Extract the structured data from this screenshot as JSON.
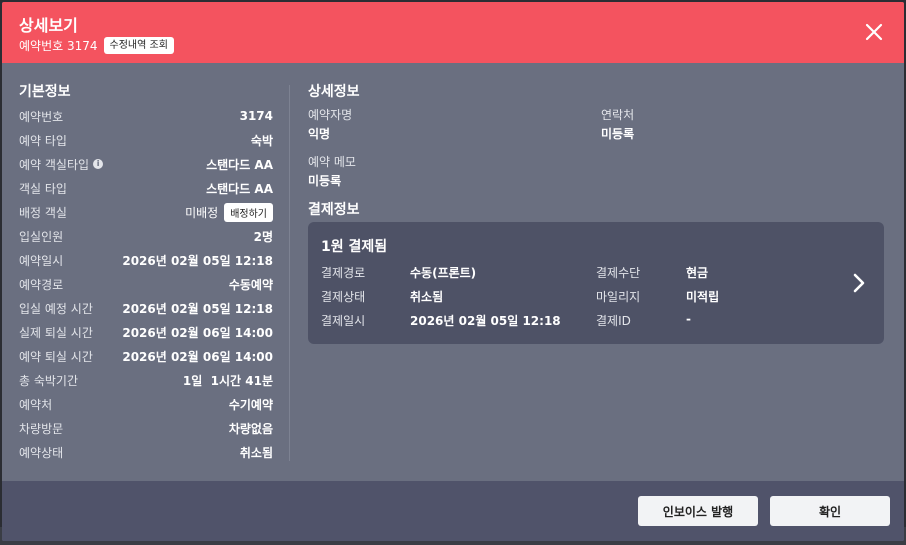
{
  "modal": {
    "title": "상세보기",
    "reservation_number_label": "예약번호 3174",
    "history_button": "수정내역 조회"
  },
  "basic_info": {
    "title": "기본정보",
    "rows": [
      {
        "label": "예약번호",
        "value": "3174"
      },
      {
        "label": "예약 타입",
        "value": "숙박"
      },
      {
        "label": "예약 객실타입",
        "value": "스탠다드 AA"
      },
      {
        "label": "객실 타입",
        "value": "스탠다드 AA"
      },
      {
        "label": "배정 객실",
        "value": "미배정",
        "button": "배정하기"
      },
      {
        "label": "입실인원",
        "value": "2명"
      },
      {
        "label": "예약일시",
        "value": "2026년 02월 05일 12:18"
      },
      {
        "label": "예약경로",
        "value": "수동예약"
      },
      {
        "label": "입실 예정 시간",
        "value": "2026년 02월 05일 12:18"
      },
      {
        "label": "실제 퇴실 시간",
        "value": "2026년 02월 06일 14:00"
      },
      {
        "label": "예약 퇴실 시간",
        "value": "2026년 02월 06일 14:00"
      },
      {
        "label": "총 숙박기간",
        "value": "1일  1시간 41분"
      },
      {
        "label": "예약처",
        "value": "수기예약"
      },
      {
        "label": "차량방문",
        "value": "차량없음"
      },
      {
        "label": "예약상태",
        "value": "취소됨"
      }
    ]
  },
  "detail_info": {
    "title": "상세정보",
    "reserver_label": "예약자명",
    "reserver_value": "익명",
    "contact_label": "연락처",
    "contact_value": "미등록",
    "memo_label": "예약 메모",
    "memo_value": "미등록"
  },
  "payment_info": {
    "title": "결제정보",
    "card_title": "1원 결제됨",
    "route_label": "결제경로",
    "route_value": "수동(프론트)",
    "method_label": "결제수단",
    "method_value": "현금",
    "status_label": "결제상태",
    "status_value": "취소됨",
    "mileage_label": "마일리지",
    "mileage_value": "미적립",
    "date_label": "결제일시",
    "date_value": "2026년 02월 05일 12:18",
    "id_label": "결제ID",
    "id_value": "-"
  },
  "footer": {
    "invoice_button": "인보이스 발행",
    "confirm_button": "확인"
  },
  "colors": {
    "header": "#f4535f",
    "body": "#6a6f80",
    "card": "#4e5266",
    "footer": "#50536a"
  }
}
